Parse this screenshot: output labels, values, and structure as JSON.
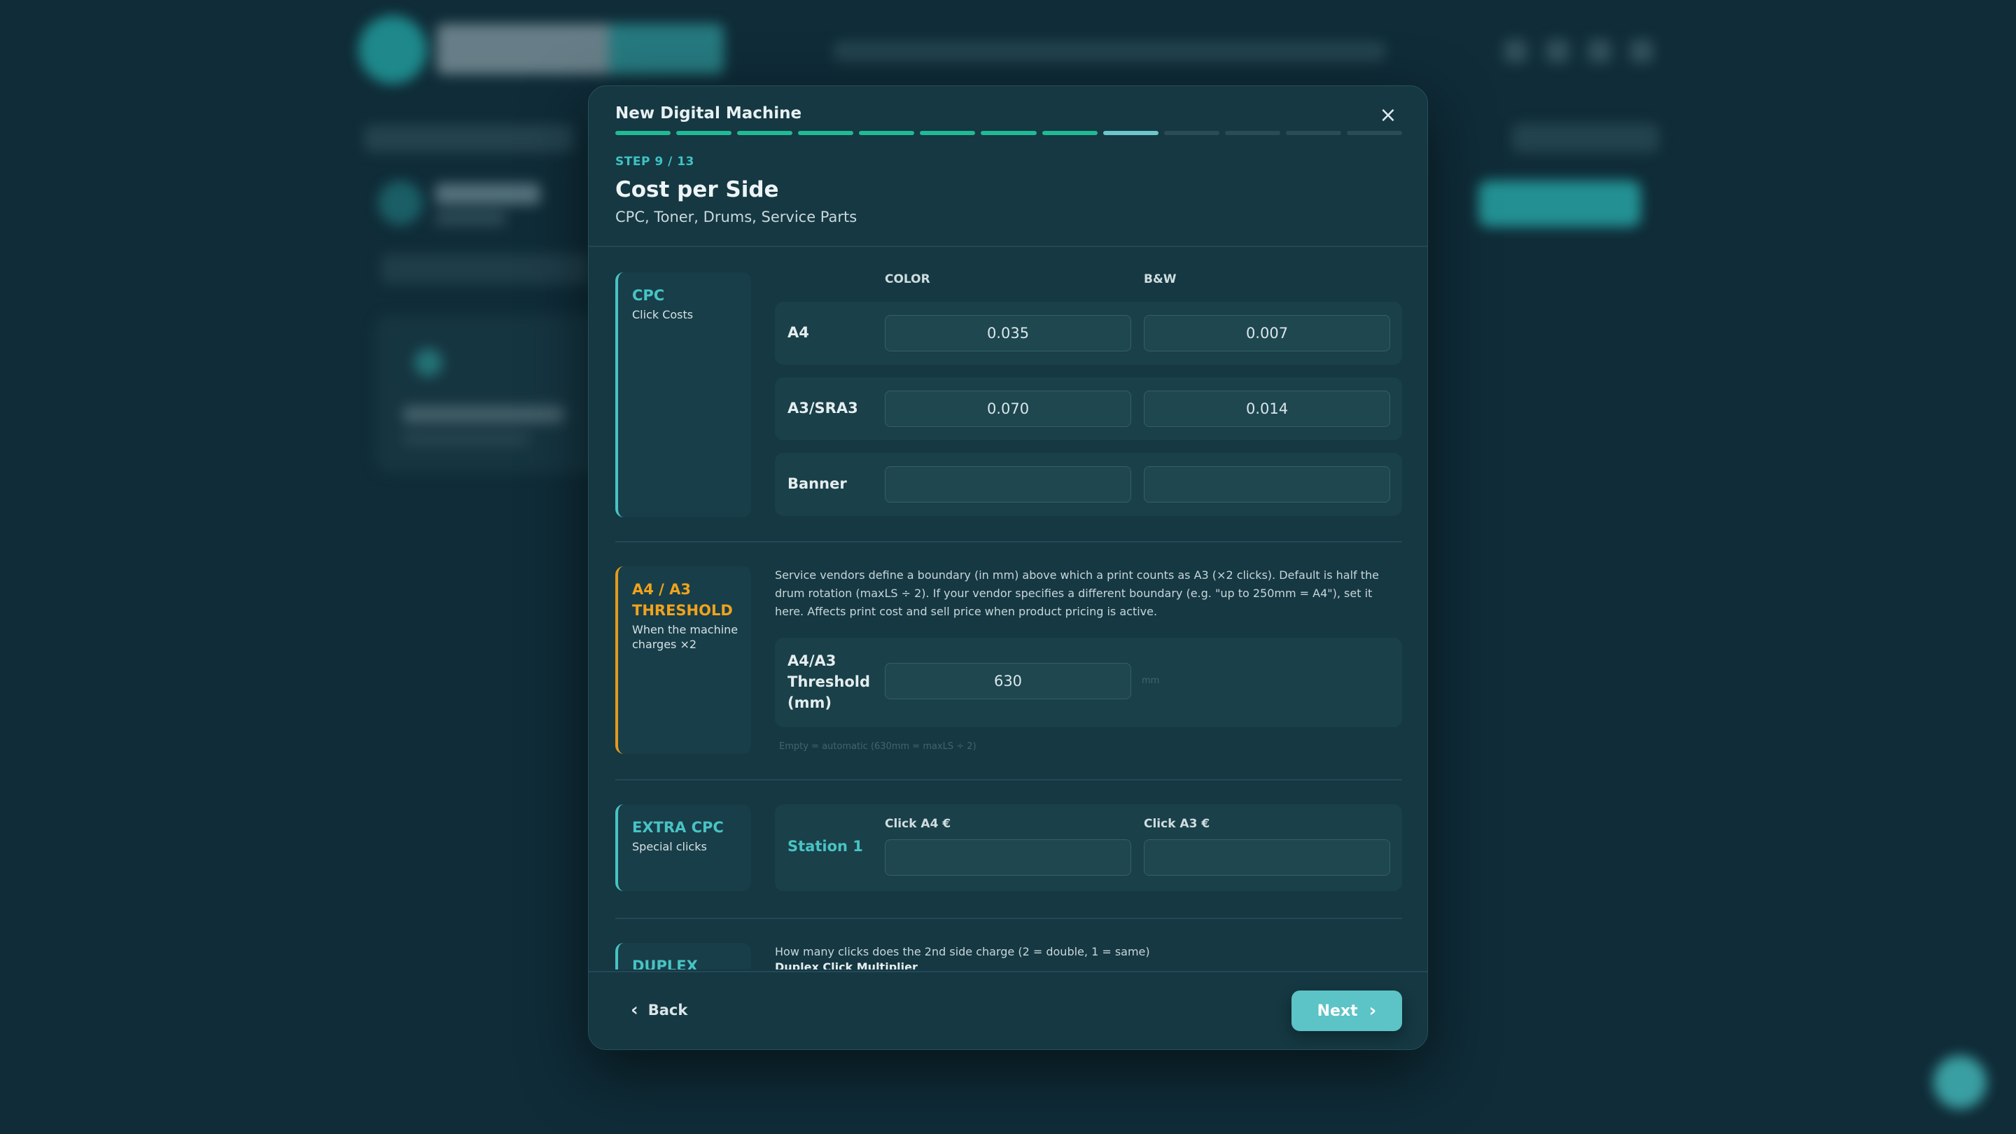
{
  "modal": {
    "title": "New Digital Machine",
    "close_icon": "×",
    "progress": {
      "total_steps": 13,
      "completed": 8,
      "current": 9
    },
    "step_label": "STEP 9 / 13",
    "page_title": "Cost per Side",
    "page_subtitle": "CPC, Toner, Drums, Service Parts"
  },
  "cpc": {
    "name": "CPC",
    "desc": "Click Costs",
    "col_color": "COLOR",
    "col_bw": "B&W",
    "rows": [
      {
        "label": "A4",
        "color": "0.035",
        "bw": "0.007"
      },
      {
        "label": "A3/SRA3",
        "color": "0.070",
        "bw": "0.014"
      },
      {
        "label": "Banner",
        "color": "",
        "bw": ""
      }
    ]
  },
  "threshold": {
    "name": "A4 / A3 THRESHOLD",
    "desc": "When the machine charges ×2",
    "note": "Service vendors define a boundary (in mm) above which a print counts as A3 (×2 clicks). Default is half the drum rotation (maxLS ÷ 2). If your vendor specifies a different boundary (e.g. \"up to 250mm = A4\"), set it here. Affects print cost and sell price when product pricing is active.",
    "field_label": "A4/A3 Threshold (mm)",
    "value": "630",
    "unit": "mm",
    "hint": "Empty = automatic (630mm = maxLS ÷ 2)"
  },
  "extra_cpc": {
    "name": "EXTRA CPC",
    "desc": "Special clicks",
    "col_a4": "Click A4 €",
    "col_a3": "Click A3 €",
    "row_label": "Station 1",
    "a4": "",
    "a3": ""
  },
  "duplex": {
    "name": "DUPLEX",
    "note": "How many clicks does the 2nd side charge (2 = double, 1 = same)",
    "field_label": "Duplex Click Multiplier"
  },
  "footer": {
    "back_label": "Back",
    "next_label": "Next",
    "back_icon": "‹",
    "next_icon": "›"
  },
  "colors": {
    "accent": "#49c3c4",
    "progress_done": "#1fbb95",
    "warning": "#f0a31c",
    "button": "#5cc3c6"
  },
  "icons": [
    "close-icon",
    "chevron-left-icon",
    "chevron-right-icon"
  ]
}
